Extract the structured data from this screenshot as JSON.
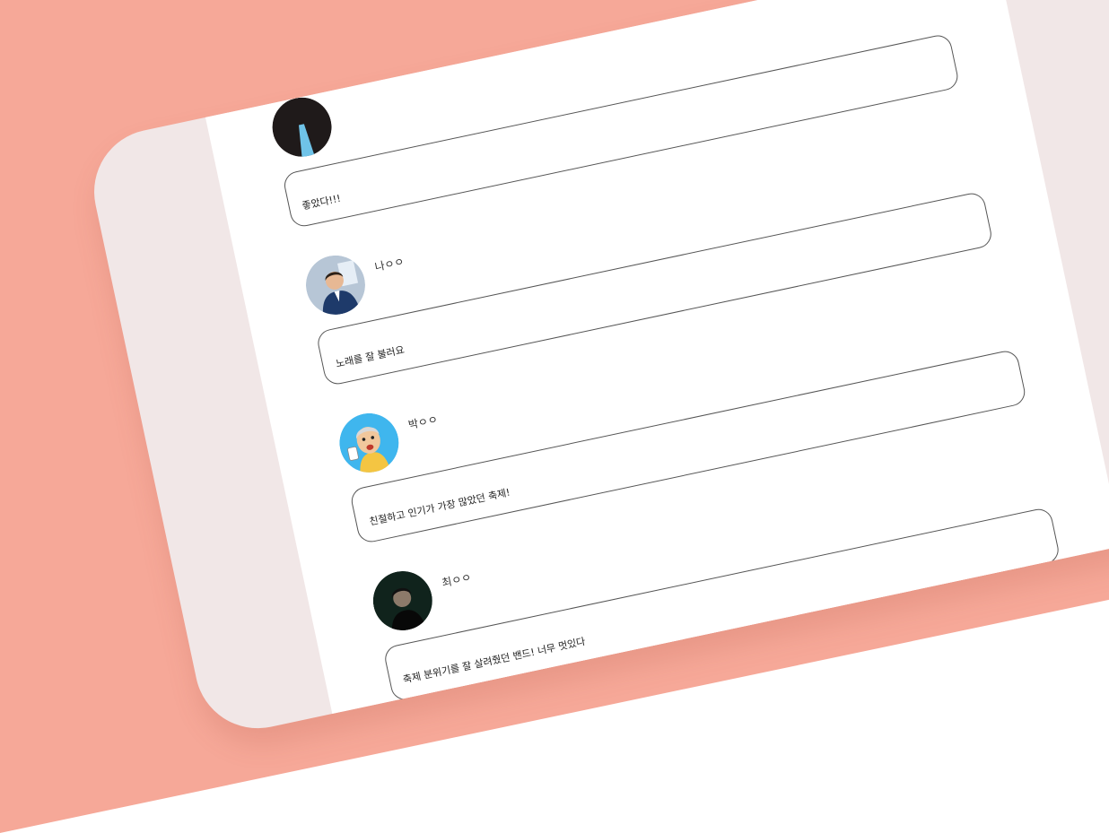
{
  "comments": [
    {
      "author": "",
      "text": "좋았다!!!",
      "avatar_icon": "dark-silhouette-avatar-icon"
    },
    {
      "author": "나ㅇㅇ",
      "text": "노래를 잘 불러요",
      "avatar_icon": "man-in-suit-avatar-icon"
    },
    {
      "author": "박ㅇㅇ",
      "text": "친절하고 인기가 가장 많았던 축제!",
      "avatar_icon": "cartoon-man-avatar-icon"
    },
    {
      "author": "최ㅇㅇ",
      "text": "축제 분위기를 잘 살려줬던 밴드! 너무 멋있다",
      "avatar_icon": "dark-portrait-avatar-icon"
    }
  ],
  "colors": {
    "background": "#f6a898",
    "card": "#f1e7e7",
    "panel": "#ffffff",
    "avatar_blue": "#3fb6ee"
  }
}
